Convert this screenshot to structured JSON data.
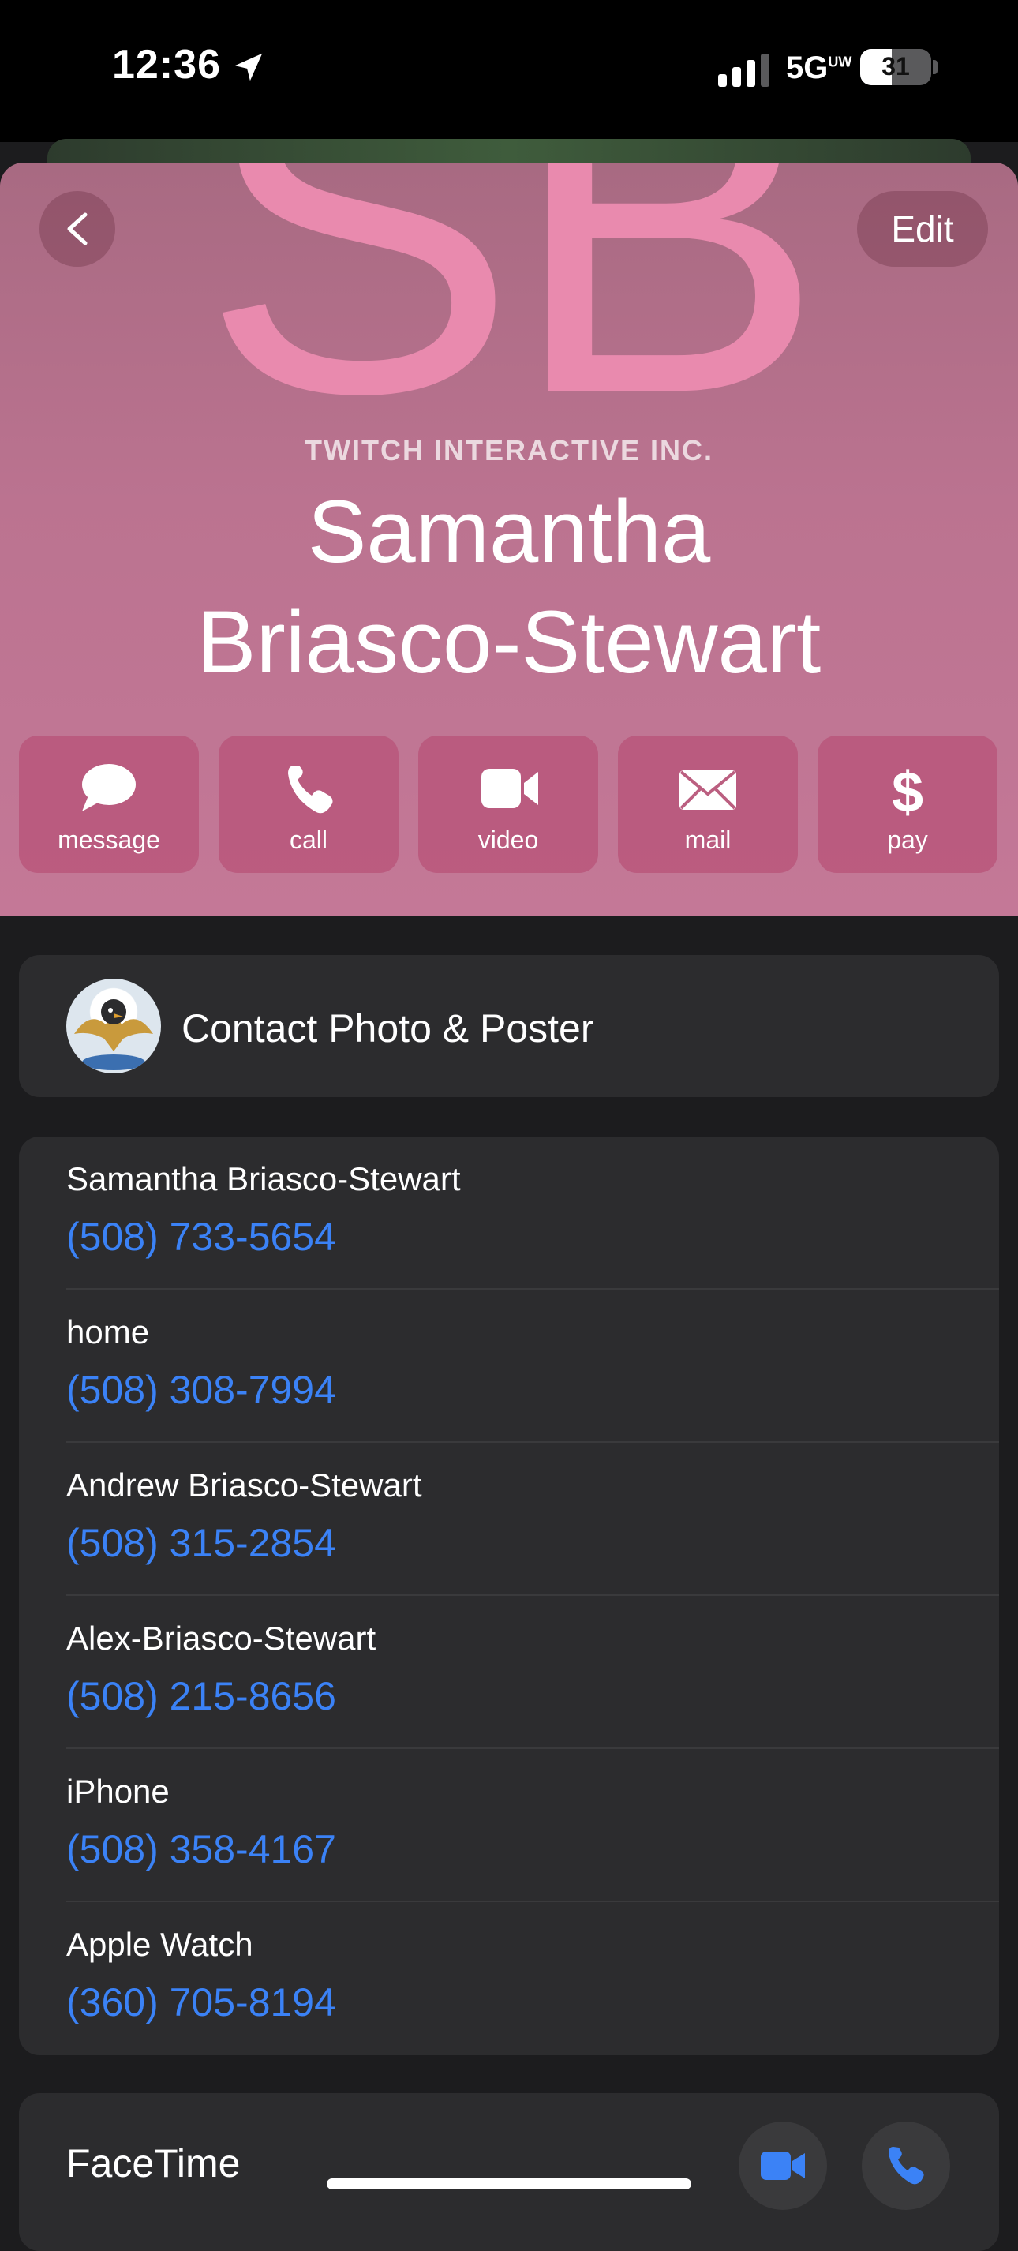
{
  "status": {
    "time": "12:36",
    "network": "5G",
    "network_sup": "UW",
    "battery": "31"
  },
  "poster": {
    "monogram": "SB",
    "company": "TWITCH INTERACTIVE INC.",
    "name_line1": "Samantha",
    "name_line2": "Briasco-Stewart",
    "edit_label": "Edit",
    "background_color": "#bb7390",
    "monogram_color": "#e98aae"
  },
  "actions": [
    {
      "label": "message",
      "icon": "message-bubble-icon"
    },
    {
      "label": "call",
      "icon": "phone-icon"
    },
    {
      "label": "video",
      "icon": "video-camera-icon"
    },
    {
      "label": "mail",
      "icon": "envelope-icon"
    },
    {
      "label": "pay",
      "icon": "dollar-icon"
    }
  ],
  "photo_card": {
    "label": "Contact Photo & Poster"
  },
  "phones": [
    {
      "label": "Samantha Briasco-Stewart",
      "number": "(508) 733-5654"
    },
    {
      "label": "home",
      "number": "(508) 308-7994"
    },
    {
      "label": "Andrew Briasco-Stewart",
      "number": "(508) 315-2854"
    },
    {
      "label": "Alex-Briasco-Stewart",
      "number": "(508) 215-8656"
    },
    {
      "label": "iPhone",
      "number": "(508) 358-4167"
    },
    {
      "label": "Apple Watch",
      "number": "(360) 705-8194"
    }
  ],
  "facetime": {
    "label": "FaceTime"
  },
  "colors": {
    "link": "#3b82f6",
    "card": "#2c2c2e",
    "background": "#1c1c1e"
  }
}
